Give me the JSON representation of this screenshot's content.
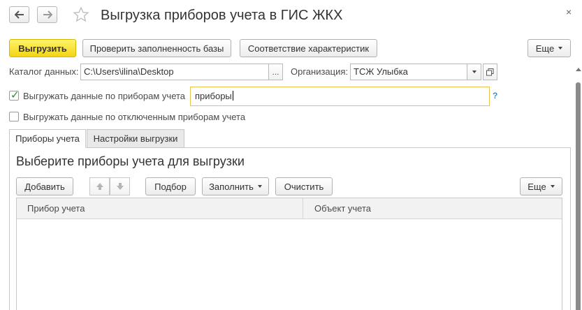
{
  "window": {
    "title": "Выгрузка приборов учета в ГИС ЖКХ",
    "close_glyph": "×",
    "icons": [
      "arrow-left-icon",
      "arrow-right-icon",
      "star-icon",
      "close-icon"
    ]
  },
  "toolbar": {
    "export_label": "Выгрузить",
    "check_db_label": "Проверить заполненность базы",
    "match_label": "Соответствие характеристик",
    "more_label": "Еще"
  },
  "form": {
    "catalog_label": "Каталог данных:",
    "catalog_value": "C:\\Users\\ilina\\Desktop",
    "catalog_button": "...",
    "org_label": "Организация:",
    "org_value": "ТСЖ Улыбка",
    "export_meters_label": "Выгружать данные по приборам учета",
    "export_meters_checked": true,
    "search_value": "приборы",
    "help_glyph": "?",
    "export_disabled_label": "Выгружать данные по отключенным приборам учета",
    "export_disabled_checked": false
  },
  "tabs": [
    {
      "label": "Приборы учета",
      "active": true
    },
    {
      "label": "Настройки выгрузки",
      "active": false
    }
  ],
  "panel": {
    "title": "Выберите приборы учета для выгрузки",
    "add_label": "Добавить",
    "pick_label": "Подбор",
    "fill_label": "Заполнить",
    "clear_label": "Очистить",
    "more_label": "Еще"
  },
  "table": {
    "columns": [
      "Прибор учета",
      "Объект учета"
    ],
    "rows": []
  },
  "colors": {
    "primary_button": "#f3d416",
    "search_border": "#e6c34a",
    "check_green": "#2d8c2d",
    "help_blue": "#3a8fcc"
  }
}
